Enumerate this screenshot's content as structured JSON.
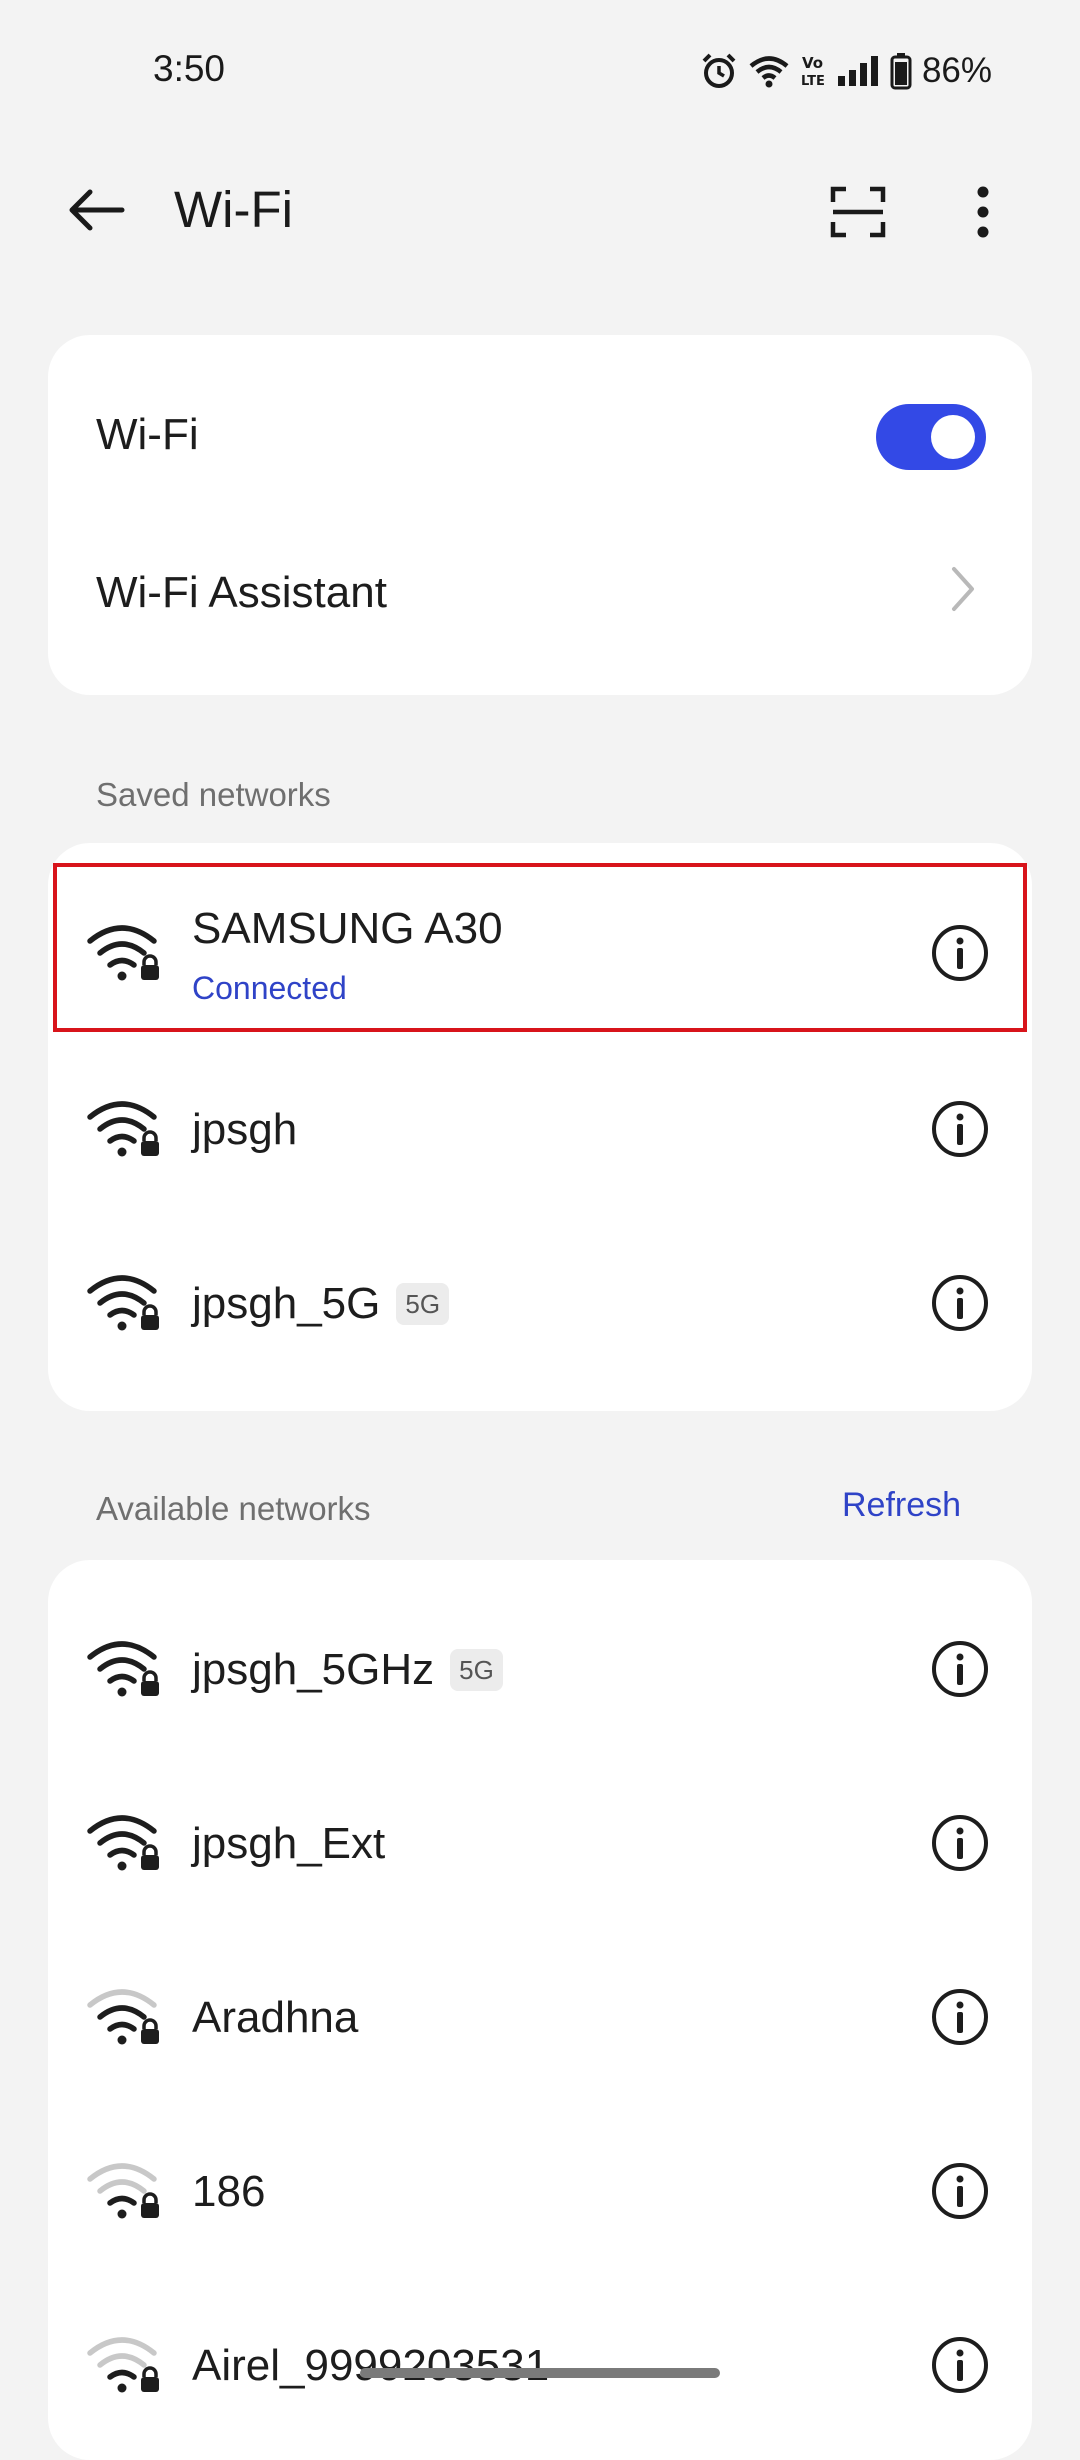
{
  "status_bar": {
    "time": "3:50",
    "battery": "86%",
    "icons": [
      "alarm-icon",
      "wifi-status-icon",
      "volte-icon",
      "signal-icon",
      "battery-icon"
    ]
  },
  "header": {
    "title": "Wi-Fi",
    "back_icon": "arrow-left-icon",
    "scan_icon": "scan-icon",
    "more_icon": "more-vertical-icon"
  },
  "settings": {
    "wifi_label": "Wi-Fi",
    "wifi_enabled": true,
    "assistant_label": "Wi-Fi Assistant"
  },
  "saved": {
    "section_label": "Saved networks",
    "networks": [
      {
        "name": "SAMSUNG A30",
        "status": "Connected",
        "badge": "",
        "strength": "full"
      },
      {
        "name": "jpsgh",
        "status": "",
        "badge": "",
        "strength": "full"
      },
      {
        "name": "jpsgh_5G",
        "status": "",
        "badge": "5G",
        "strength": "full"
      }
    ]
  },
  "available": {
    "section_label": "Available networks",
    "refresh_label": "Refresh",
    "networks": [
      {
        "name": "jpsgh_5GHz",
        "badge": "5G",
        "strength": "full"
      },
      {
        "name": "jpsgh_Ext",
        "badge": "",
        "strength": "full"
      },
      {
        "name": "Aradhna",
        "badge": "",
        "strength": "medium"
      },
      {
        "name": "186",
        "badge": "",
        "strength": "weak"
      },
      {
        "name": "Airel_9999203531",
        "badge": "",
        "strength": "weak"
      }
    ]
  },
  "colors": {
    "accent": "#3349e6",
    "link": "#2f43c7",
    "highlight_border": "#d8141b",
    "background": "#f3f3f3"
  }
}
